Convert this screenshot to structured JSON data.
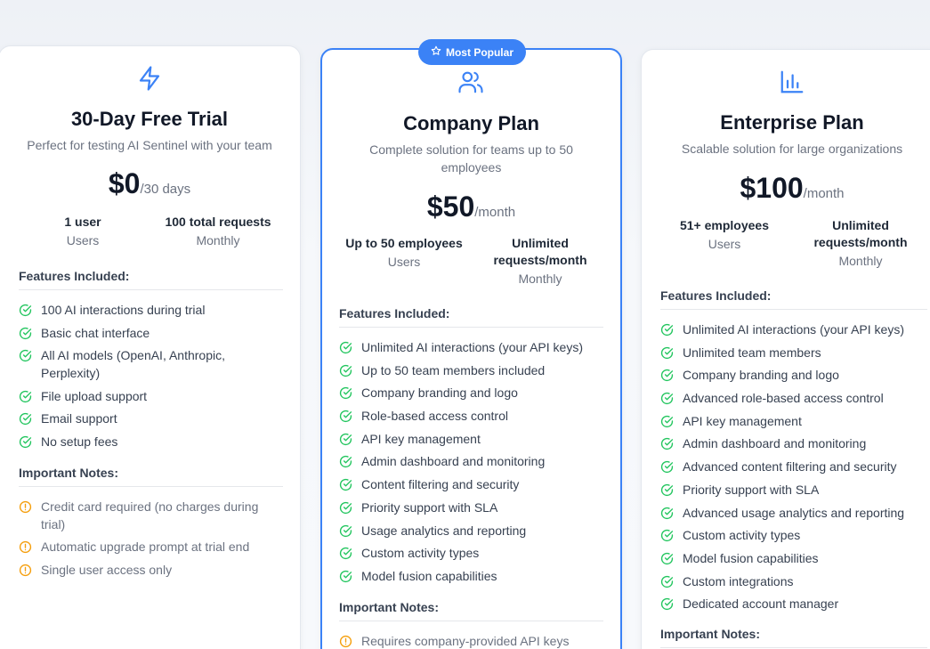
{
  "colors": {
    "accent": "#3b82f6",
    "check": "#22c55e",
    "warning": "#f59e0b"
  },
  "plans": {
    "free": {
      "icon": "lightning-icon",
      "title": "30-Day Free Trial",
      "subtitle": "Perfect for testing AI Sentinel with your team",
      "price": "$0",
      "period": "/30 days",
      "stats": [
        {
          "value": "1 user",
          "label": "Users"
        },
        {
          "value": "100 total requests",
          "label": "Monthly"
        }
      ],
      "features_title": "Features Included:",
      "features": [
        "100 AI interactions during trial",
        "Basic chat interface",
        "All AI models (OpenAI, Anthropic, Perplexity)",
        "File upload support",
        "Email support",
        "No setup fees"
      ],
      "notes_title": "Important Notes:",
      "notes": [
        "Credit card required (no charges during trial)",
        "Automatic upgrade prompt at trial end",
        "Single user access only"
      ]
    },
    "company": {
      "badge": "Most Popular",
      "icon": "users-icon",
      "title": "Company Plan",
      "subtitle": "Complete solution for teams up to 50 employees",
      "price": "$50",
      "period": "/month",
      "stats": [
        {
          "value": "Up to 50 employees",
          "label": "Users"
        },
        {
          "value": "Unlimited requests/month",
          "label": "Monthly"
        }
      ],
      "features_title": "Features Included:",
      "features": [
        "Unlimited AI interactions (your API keys)",
        "Up to 50 team members included",
        "Company branding and logo",
        "Role-based access control",
        "API key management",
        "Admin dashboard and monitoring",
        "Content filtering and security",
        "Priority support with SLA",
        "Usage analytics and reporting",
        "Custom activity types",
        "Model fusion capabilities"
      ],
      "notes_title": "Important Notes:",
      "notes": [
        "Requires company-provided API keys"
      ]
    },
    "enterprise": {
      "icon": "bar-chart-icon",
      "title": "Enterprise Plan",
      "subtitle": "Scalable solution for large organizations",
      "price": "$100",
      "period": "/month",
      "stats": [
        {
          "value": "51+ employees",
          "label": "Users"
        },
        {
          "value": "Unlimited requests/month",
          "label": "Monthly"
        }
      ],
      "features_title": "Features Included:",
      "features": [
        "Unlimited AI interactions (your API keys)",
        "Unlimited team members",
        "Company branding and logo",
        "Advanced role-based access control",
        "API key management",
        "Admin dashboard and monitoring",
        "Advanced content filtering and security",
        "Priority support with SLA",
        "Advanced usage analytics and reporting",
        "Custom activity types",
        "Model fusion capabilities",
        "Custom integrations",
        "Dedicated account manager"
      ],
      "notes_title": "Important Notes:"
    }
  }
}
